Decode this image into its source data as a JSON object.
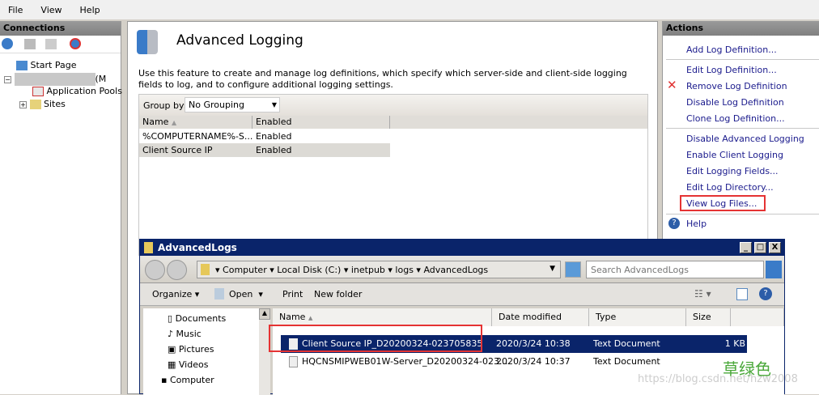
{
  "menu": [
    "File",
    "View",
    "Help"
  ],
  "connections": {
    "title": "Connections",
    "tree": [
      "Start Page",
      "(M",
      "Application Pools",
      "Sites"
    ]
  },
  "feature": {
    "title": "Advanced Logging",
    "description": "Use this feature to create and manage log definitions, which specify which server-side and client-side logging fields to log, and to configure additional logging settings.",
    "group_by_label": "Group by:",
    "group_by_value": "No Grouping",
    "columns": [
      "Name",
      "Enabled"
    ],
    "rows": [
      [
        "%COMPUTERNAME%-S...",
        "Enabled"
      ],
      [
        "Client Source IP",
        "Enabled"
      ]
    ]
  },
  "actions": {
    "title": "Actions",
    "items": [
      "Add Log Definition...",
      "Edit Log Definition...",
      "Remove Log Definition",
      "Disable Log Definition",
      "Clone Log Definition...",
      "Disable Advanced Logging",
      "Enable Client Logging",
      "Edit Logging Fields...",
      "Edit Log Directory...",
      "View Log Files...",
      "Help"
    ]
  },
  "explorer": {
    "title": "AdvancedLogs",
    "breadcrumb": [
      "Computer",
      "Local Disk (C:)",
      "inetpub",
      "logs",
      "AdvancedLogs"
    ],
    "search_placeholder": "Search AdvancedLogs",
    "toolbar": [
      "Organize",
      "Open",
      "Print",
      "New folder"
    ],
    "nav": [
      "Documents",
      "Music",
      "Pictures",
      "Videos",
      "Computer"
    ],
    "columns": [
      "Name",
      "Date modified",
      "Type",
      "Size"
    ],
    "files": [
      {
        "name": "Client Source IP_D20200324-023705835",
        "date": "2020/3/24 10:38",
        "type": "Text Document",
        "size": "1 KB",
        "selected": true
      },
      {
        "name": "HQCNSMIPWEB01W-Server_D20200324-023...",
        "date": "2020/3/24 10:37",
        "type": "Text Document",
        "size": "",
        "selected": false
      }
    ]
  },
  "watermark": {
    "cn": "草绿色",
    "url": "https://blog.csdn.net/hzw2008"
  },
  "colors": {
    "selection": "#0a246a",
    "highlight": "#e53333",
    "link": "#1a1a8c"
  }
}
